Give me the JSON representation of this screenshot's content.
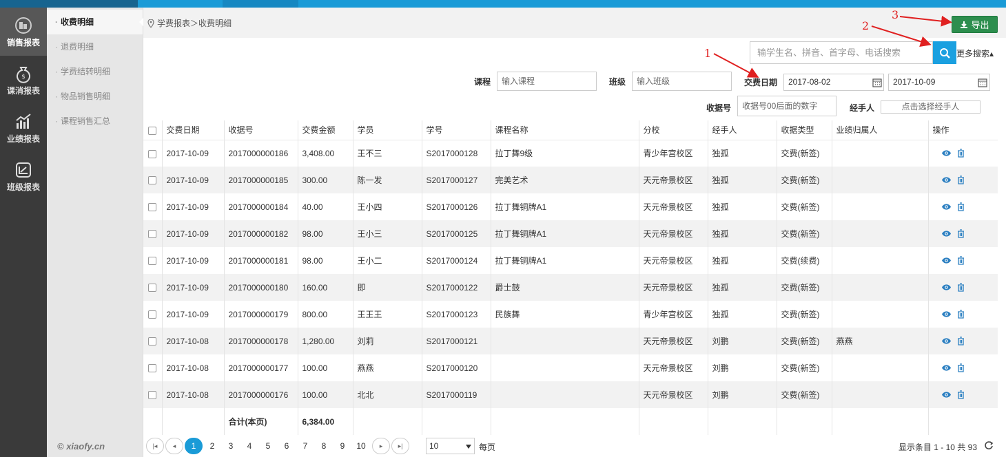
{
  "sidebar": {
    "items": [
      {
        "label": "销售报表",
        "icon": "chart-pie-icon",
        "active": true
      },
      {
        "label": "课消报表",
        "icon": "money-bag-icon",
        "active": false
      },
      {
        "label": "业绩报表",
        "icon": "bar-chart-icon",
        "active": false
      },
      {
        "label": "班级报表",
        "icon": "line-chart-icon",
        "active": false
      }
    ]
  },
  "submenu": {
    "items": [
      {
        "label": "收费明细",
        "active": true
      },
      {
        "label": "退费明细",
        "active": false
      },
      {
        "label": "学费结转明细",
        "active": false
      },
      {
        "label": "物品销售明细",
        "active": false
      },
      {
        "label": "课程销售汇总",
        "active": false
      }
    ],
    "brand": "© xiaofy.cn"
  },
  "breadcrumb": "学费报表＞收费明细",
  "toolbar": {
    "export_label": "导出"
  },
  "search": {
    "placeholder": "输学生名、拼音、首字母、电话搜索",
    "more_label": "更多搜索▴"
  },
  "filters": {
    "course_label": "课程",
    "course_placeholder": "输入课程",
    "class_label": "班级",
    "class_placeholder": "输入班级",
    "date_label": "交费日期",
    "date_from": "2017-08-02",
    "date_to": "2017-10-09",
    "receipt_label": "收据号",
    "receipt_placeholder": "收据号00后面的数字",
    "handler_label": "经手人",
    "handler_placeholder": "点击选择经手人"
  },
  "annotations": [
    "1",
    "2",
    "3"
  ],
  "table": {
    "headers": [
      "交费日期",
      "收据号",
      "交费金额",
      "学员",
      "学号",
      "课程名称",
      "分校",
      "经手人",
      "收据类型",
      "业绩归属人",
      "操作"
    ],
    "rows": [
      [
        "2017-10-09",
        "2017000000186",
        "3,408.00",
        "王不三",
        "S2017000128",
        "拉丁舞9级",
        "青少年宫校区",
        "独孤",
        "交费(新签)",
        ""
      ],
      [
        "2017-10-09",
        "2017000000185",
        "300.00",
        "陈一发",
        "S2017000127",
        "完美艺术",
        "天元帝景校区",
        "独孤",
        "交费(新签)",
        ""
      ],
      [
        "2017-10-09",
        "2017000000184",
        "40.00",
        "王小四",
        "S2017000126",
        "拉丁舞铜牌A1",
        "天元帝景校区",
        "独孤",
        "交费(新签)",
        ""
      ],
      [
        "2017-10-09",
        "2017000000182",
        "98.00",
        "王小三",
        "S2017000125",
        "拉丁舞铜牌A1",
        "天元帝景校区",
        "独孤",
        "交费(新签)",
        ""
      ],
      [
        "2017-10-09",
        "2017000000181",
        "98.00",
        "王小二",
        "S2017000124",
        "拉丁舞铜牌A1",
        "天元帝景校区",
        "独孤",
        "交费(续费)",
        ""
      ],
      [
        "2017-10-09",
        "2017000000180",
        "160.00",
        "即",
        "S2017000122",
        "爵士鼓",
        "天元帝景校区",
        "独孤",
        "交费(新签)",
        ""
      ],
      [
        "2017-10-09",
        "2017000000179",
        "800.00",
        "王王王",
        "S2017000123",
        "民族舞",
        "青少年宫校区",
        "独孤",
        "交费(新签)",
        ""
      ],
      [
        "2017-10-08",
        "2017000000178",
        "1,280.00",
        "刘莉",
        "S2017000121",
        "",
        "天元帝景校区",
        "刘鹏",
        "交费(新签)",
        "燕燕"
      ],
      [
        "2017-10-08",
        "2017000000177",
        "100.00",
        "燕燕",
        "S2017000120",
        "",
        "天元帝景校区",
        "刘鹏",
        "交费(新签)",
        ""
      ],
      [
        "2017-10-08",
        "2017000000176",
        "100.00",
        "北北",
        "S2017000119",
        "",
        "天元帝景校区",
        "刘鹏",
        "交费(新签)",
        ""
      ]
    ],
    "summary": {
      "label": "合计(本页)",
      "total": "6,384.00"
    }
  },
  "pager": {
    "pages": [
      "1",
      "2",
      "3",
      "4",
      "5",
      "6",
      "7",
      "8",
      "9",
      "10"
    ],
    "current": "1",
    "page_size": "10",
    "per_page_label": "每页",
    "info": "显示条目 1 - 10 共 93"
  }
}
